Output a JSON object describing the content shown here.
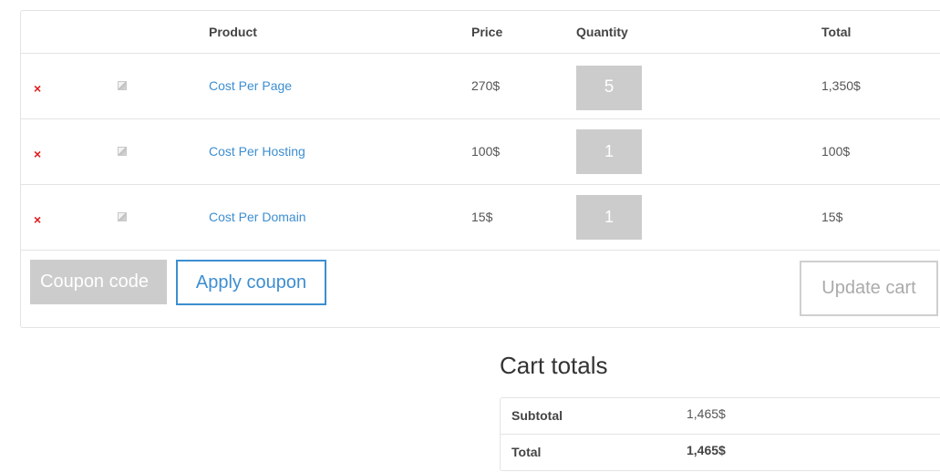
{
  "cart": {
    "headers": {
      "product": "Product",
      "price": "Price",
      "quantity": "Quantity",
      "total": "Total"
    },
    "remove_symbol": "×",
    "items": [
      {
        "name": "Cost Per Page",
        "price": "270$",
        "quantity": "5",
        "total": "1,350$"
      },
      {
        "name": "Cost Per Hosting",
        "price": "100$",
        "quantity": "1",
        "total": "100$"
      },
      {
        "name": "Cost Per Domain",
        "price": "15$",
        "quantity": "1",
        "total": "15$"
      }
    ],
    "coupon_placeholder": "Coupon code",
    "apply_coupon_label": "Apply coupon",
    "update_cart_label": "Update cart"
  },
  "totals": {
    "title": "Cart totals",
    "subtotal_label": "Subtotal",
    "subtotal_value": "1,465$",
    "total_label": "Total",
    "total_value": "1,465$"
  },
  "colors": {
    "link": "#3d8ed1",
    "remove": "#e01b1b",
    "input_bg": "#cccccc",
    "border": "#e3e3e3"
  }
}
